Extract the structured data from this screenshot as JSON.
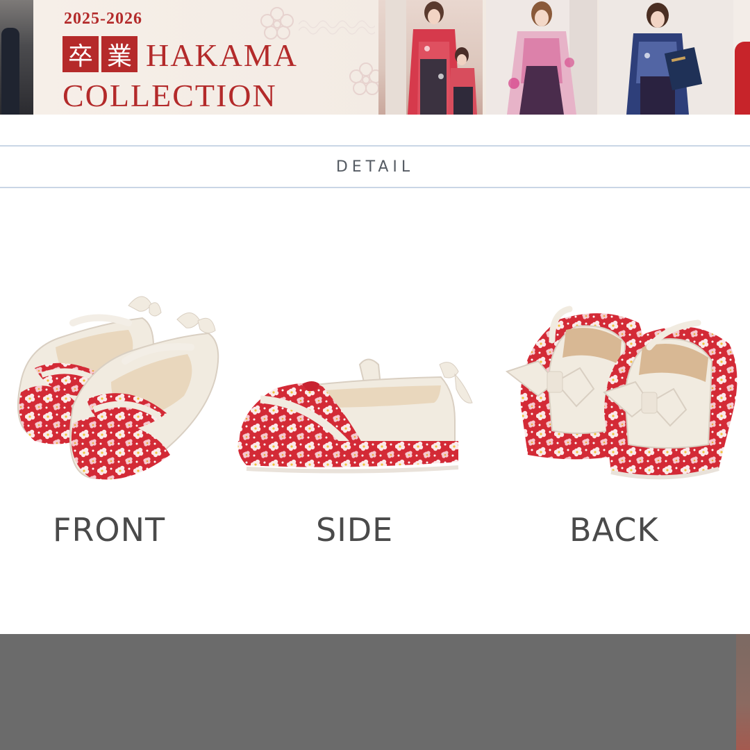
{
  "banner": {
    "year": "2025-2026",
    "kanji": [
      "卒",
      "業"
    ],
    "title_line1": "HAKAMA",
    "title_line2": "COLLECTION"
  },
  "detail": {
    "heading": "DETAIL"
  },
  "views": [
    {
      "label": "FRONT"
    },
    {
      "label": "SIDE"
    },
    {
      "label": "BACK"
    }
  ],
  "colors": {
    "brand_red": "#b32a2a",
    "shoe_red": "#d32a36",
    "shoe_cream": "#f1ebe0",
    "divider_blue": "#c9d6e6",
    "bottom_gray": "#6b6b6b"
  }
}
